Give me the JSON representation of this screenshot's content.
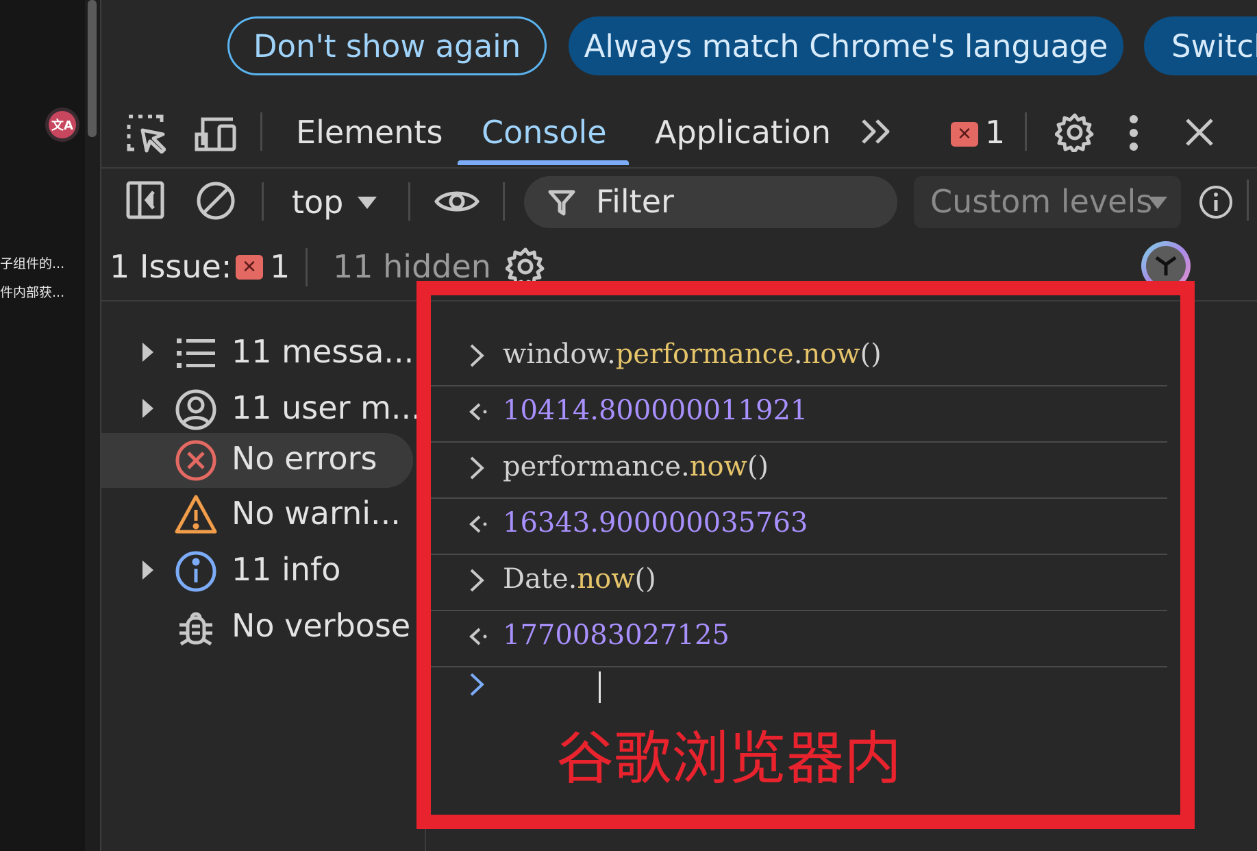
{
  "page": {
    "snippets": [
      "子组件的...",
      "件内部获..."
    ]
  },
  "infobar": {
    "dont_show": "Don't show again",
    "always_match": "Always match Chrome's language",
    "switch": "Switch"
  },
  "toolbar": {
    "tabs": [
      "Elements",
      "Console",
      "Application"
    ],
    "active_tab": "Console",
    "error_count": "1"
  },
  "console_toolbar": {
    "context": "top",
    "filter_placeholder": "Filter",
    "levels": "Custom levels"
  },
  "issues": {
    "label": "1 Issue:",
    "count": "1",
    "hidden": "11 hidden"
  },
  "sidebar": {
    "items": [
      {
        "label": "11 messa...",
        "icon": "list-icon",
        "expandable": true
      },
      {
        "label": "11 user m...",
        "icon": "user-icon",
        "expandable": true
      },
      {
        "label": "No errors",
        "icon": "error-icon",
        "expandable": false,
        "selected": true
      },
      {
        "label": "No warni...",
        "icon": "warning-icon",
        "expandable": false
      },
      {
        "label": "11 info",
        "icon": "info-icon",
        "expandable": true
      },
      {
        "label": "No verbose",
        "icon": "bug-icon",
        "expandable": false
      }
    ]
  },
  "console": {
    "entries": [
      {
        "kind": "input",
        "parts": [
          [
            "window.",
            "plain"
          ],
          [
            "performance",
            "prop"
          ],
          [
            ".",
            "plain"
          ],
          [
            "now",
            "prop"
          ],
          [
            "()",
            "plain"
          ]
        ]
      },
      {
        "kind": "output",
        "parts": [
          [
            "10414.800000011921",
            "num"
          ]
        ]
      },
      {
        "kind": "input",
        "parts": [
          [
            "performance.",
            "plain"
          ],
          [
            "now",
            "prop"
          ],
          [
            "()",
            "plain"
          ]
        ]
      },
      {
        "kind": "output",
        "parts": [
          [
            "16343.900000035763",
            "num"
          ]
        ]
      },
      {
        "kind": "input",
        "parts": [
          [
            "Date.",
            "plain"
          ],
          [
            "now",
            "prop"
          ],
          [
            "()",
            "plain"
          ]
        ]
      },
      {
        "kind": "output",
        "parts": [
          [
            "1770083027125",
            "num"
          ]
        ]
      }
    ]
  },
  "annotation": {
    "text": "谷歌浏览器内",
    "color": "#e8232e"
  },
  "colors": {
    "accent": "#7cacf8",
    "error": "#e46962",
    "warning": "#f29d49",
    "number": "#a990ff",
    "property": "#e5c46a"
  }
}
